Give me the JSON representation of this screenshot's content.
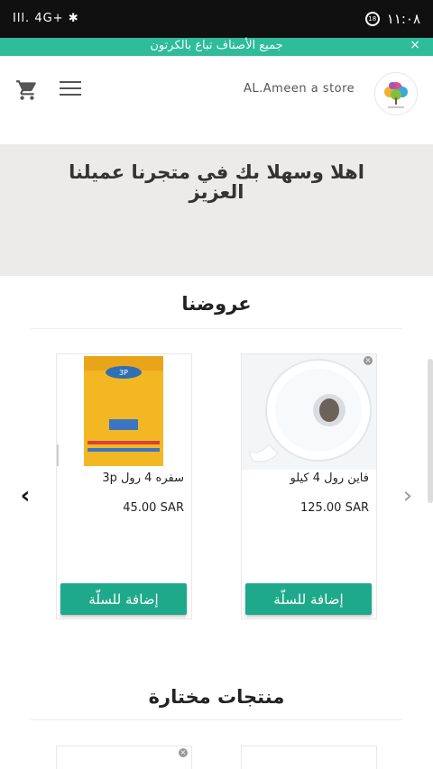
{
  "status_bar": {
    "signal_text": "Ill. 4G+ ✱",
    "time": "١١:٠٨"
  },
  "promo": {
    "text": "جميع الأصناف تباع بالكرتون",
    "close": "×"
  },
  "header": {
    "store_name": "AL.Ameen a store"
  },
  "hero": {
    "text": "اهلا وسهلا بك في متجرنا عميلنا العزيز"
  },
  "offers": {
    "title": "عروضنا",
    "products": [
      {
        "name": "فاين رول 4 كيلو",
        "price": "125.00 SAR",
        "add_label": "إضافة للسلّة"
      },
      {
        "name": "سفره 4 رول 3p",
        "price": "45.00 SAR",
        "add_label": "إضافة للسلّة"
      }
    ]
  },
  "featured": {
    "title": "منتجات مختارة"
  },
  "carousel": {
    "prev": "‹",
    "next": "›"
  },
  "colors": {
    "accent": "#2ebc9a",
    "button": "#1fa98b"
  }
}
